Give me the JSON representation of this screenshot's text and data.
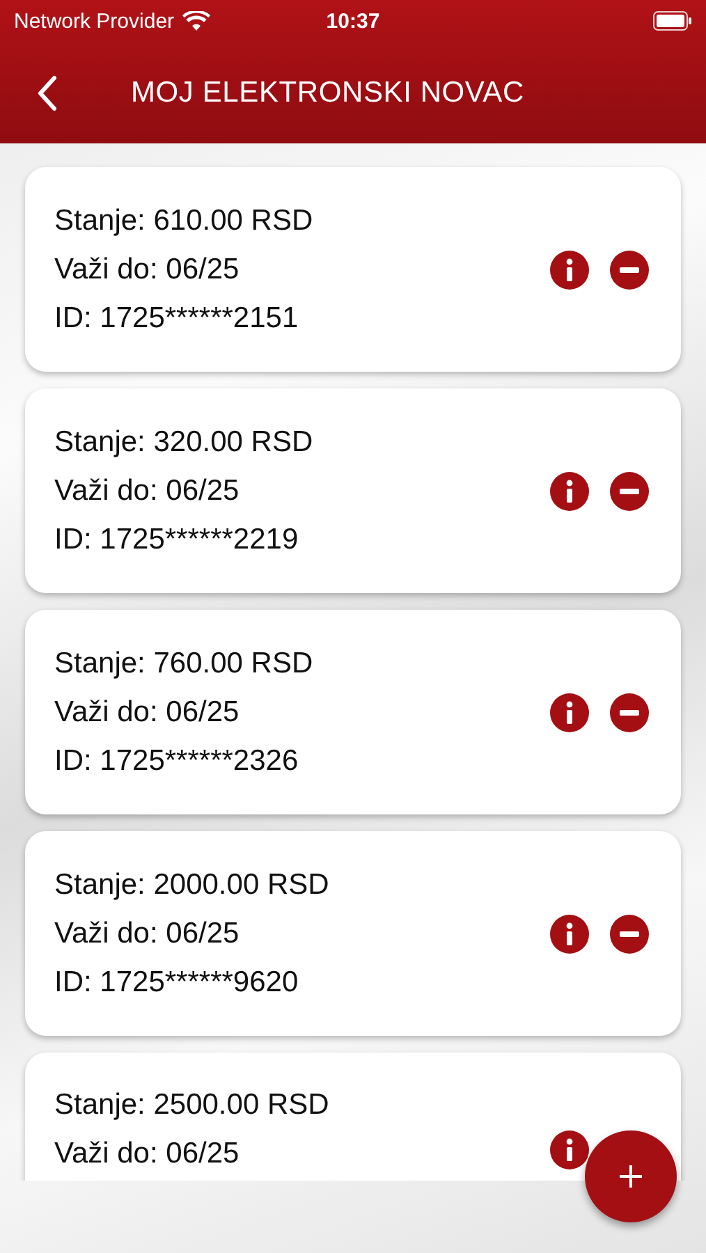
{
  "status_bar": {
    "carrier": "Network Provider",
    "time": "10:37"
  },
  "header": {
    "title": "MOJ ELEKTRONSKI NOVAC"
  },
  "cards": [
    {
      "lines": [
        "Stanje: 610.00 RSD",
        "Važi do: 06/25",
        "ID: 1725******2151"
      ],
      "actions": [
        {
          "kind": "info"
        },
        {
          "kind": "remove"
        }
      ]
    },
    {
      "lines": [
        "Stanje: 320.00 RSD",
        "Važi do: 06/25",
        "ID: 1725******2219"
      ],
      "actions": [
        {
          "kind": "info"
        },
        {
          "kind": "remove"
        }
      ]
    },
    {
      "lines": [
        "Stanje: 760.00 RSD",
        "Važi do: 06/25",
        "ID: 1725******2326"
      ],
      "actions": [
        {
          "kind": "info"
        },
        {
          "kind": "remove"
        }
      ]
    },
    {
      "lines": [
        "Stanje: 2000.00 RSD",
        "Važi do: 06/25",
        "ID: 1725******9620"
      ],
      "actions": [
        {
          "kind": "info"
        },
        {
          "kind": "remove"
        }
      ]
    },
    {
      "lines": [
        "Stanje: 2500.00 RSD",
        "Važi do: 06/25"
      ],
      "actions": [
        {
          "kind": "info"
        }
      ]
    }
  ]
}
